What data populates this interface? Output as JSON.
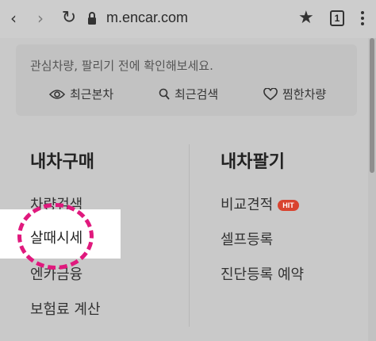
{
  "browser": {
    "url": "m.encar.com",
    "tab_count": "1"
  },
  "notice": {
    "text": "관심차량, 팔리기 전에 확인해보세요.",
    "quick_links": [
      {
        "label": "최근본차",
        "icon": "eye-icon"
      },
      {
        "label": "최근검색",
        "icon": "search-icon"
      },
      {
        "label": "찜한차량",
        "icon": "heart-icon"
      }
    ]
  },
  "buy": {
    "title": "내차구매",
    "items": [
      "차량검색",
      "살때시세",
      "엔카금융",
      "보험료 계산"
    ]
  },
  "sell": {
    "title": "내차팔기",
    "items": [
      "비교견적",
      "셀프등록",
      "진단등록 예약"
    ],
    "badge": "HIT"
  },
  "colors": {
    "highlight_circle": "#e0197d",
    "badge": "#d9432f"
  }
}
